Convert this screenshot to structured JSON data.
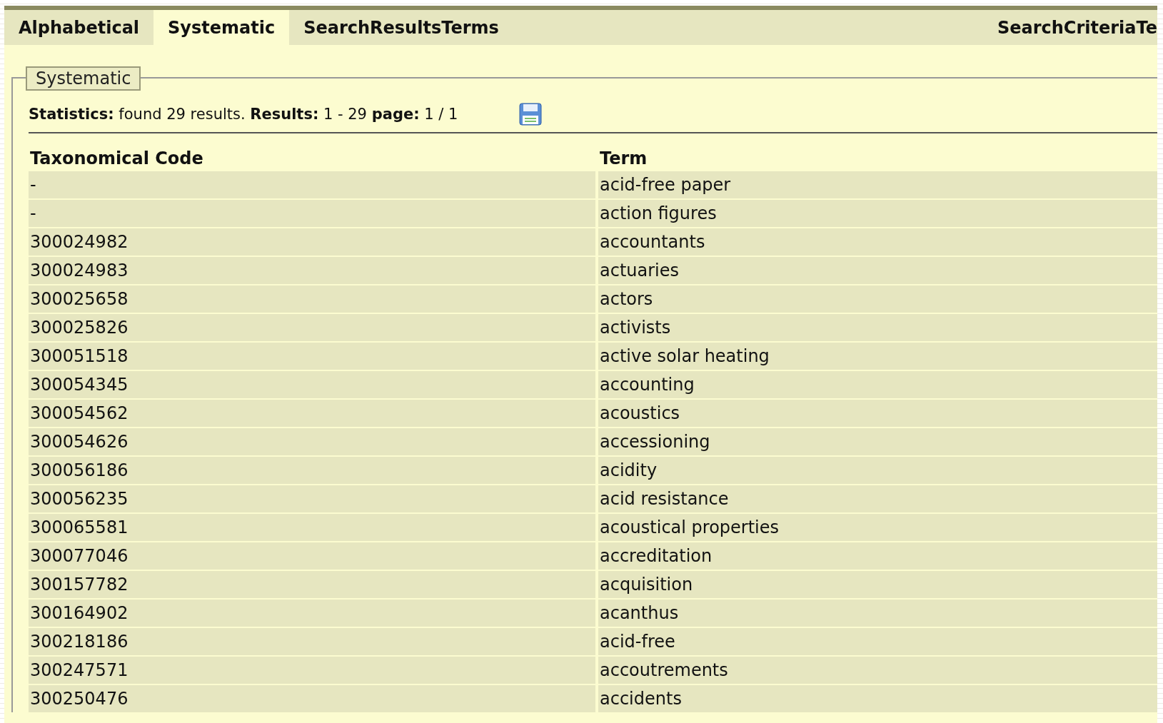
{
  "tabs": [
    {
      "label": "Alphabetical",
      "selected": false
    },
    {
      "label": "Systematic",
      "selected": true
    },
    {
      "label": "SearchResultsTerms",
      "selected": false
    },
    {
      "label": "SearchCriteriaTe",
      "selected": false
    }
  ],
  "panel": {
    "legend": "Systematic",
    "statistics": "**Statistics:** found 29 results. **Results:** 1 - 29 **page:** 1 / 1"
  },
  "table": {
    "columns": [
      "Taxonomical Code",
      "Term"
    ],
    "rows": [
      [
        "-",
        "acid-free paper"
      ],
      [
        "-",
        "action figures"
      ],
      [
        "300024982",
        "accountants"
      ],
      [
        "300024983",
        "actuaries"
      ],
      [
        "300025658",
        "actors"
      ],
      [
        "300025826",
        "activists"
      ],
      [
        "300051518",
        "active solar heating"
      ],
      [
        "300054345",
        "accounting"
      ],
      [
        "300054562",
        "acoustics"
      ],
      [
        "300054626",
        "accessioning"
      ],
      [
        "300056186",
        "acidity"
      ],
      [
        "300056235",
        "acid resistance"
      ],
      [
        "300065581",
        "acoustical properties"
      ],
      [
        "300077046",
        "accreditation"
      ],
      [
        "300157782",
        "acquisition"
      ],
      [
        "300164902",
        "acanthus"
      ],
      [
        "300218186",
        "acid-free"
      ],
      [
        "300247571",
        "accoutrements"
      ],
      [
        "300250476",
        "accidents"
      ]
    ]
  }
}
